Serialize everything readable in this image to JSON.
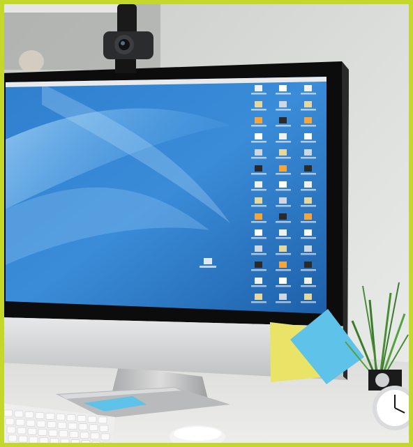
{
  "scene": {
    "description_kind": "photo",
    "frame_color": "#c4d82b",
    "objects": [
      {
        "name": "webcam",
        "icon": "webcam-icon"
      },
      {
        "name": "imac-monitor",
        "icon": "monitor-icon"
      },
      {
        "name": "desktop-wallpaper",
        "icon": "wallpaper-icon"
      },
      {
        "name": "sticky-note-yellow",
        "icon": "sticky-note-icon"
      },
      {
        "name": "sticky-note-blue",
        "icon": "sticky-note-icon"
      },
      {
        "name": "keyboard",
        "icon": "keyboard-icon"
      },
      {
        "name": "mouse",
        "icon": "mouse-icon"
      },
      {
        "name": "potted-plant",
        "icon": "plant-icon"
      },
      {
        "name": "alarm-clock",
        "icon": "clock-icon"
      }
    ],
    "colors": {
      "wall": "#d8dad8",
      "desk": "#e4e5e3",
      "screen_blue": "#2c78c4",
      "screen_light": "#79b6e8",
      "sticky_yellow": "#e9e467",
      "sticky_blue": "#5fc2e8",
      "bezel": "#0c0c0d",
      "aluminium": "#c9cacb"
    }
  }
}
